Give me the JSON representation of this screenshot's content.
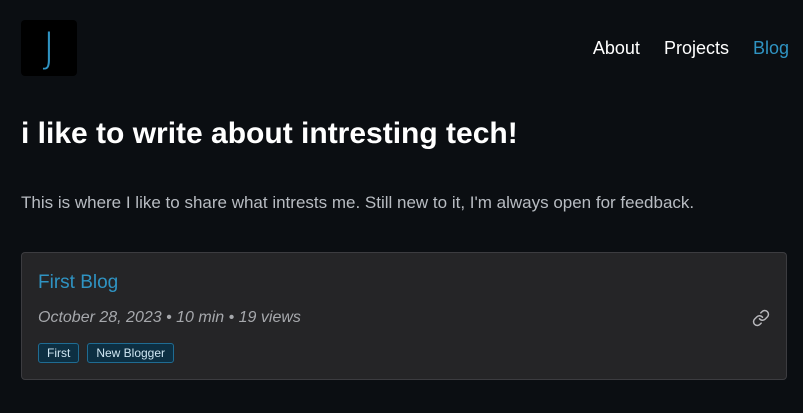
{
  "header": {
    "logo_letter": "J",
    "nav": [
      {
        "label": "About"
      },
      {
        "label": "Projects"
      },
      {
        "label": "Blog",
        "active": true
      }
    ]
  },
  "main": {
    "headline": "i like to write about intresting tech!",
    "intro": "This is where I like to share what intrests me. Still new to it, I'm always open for feedback."
  },
  "posts": [
    {
      "title": "First Blog",
      "meta": "October 28, 2023 • 10 min • 19 views",
      "tags": [
        "First",
        "New Blogger"
      ],
      "link_icon": "link-icon"
    }
  ],
  "colors": {
    "background": "#0b0e12",
    "accent": "#2f93c2",
    "card": "#252527",
    "tag_bg": "#0d2f42",
    "tag_border": "#1f6c93"
  }
}
